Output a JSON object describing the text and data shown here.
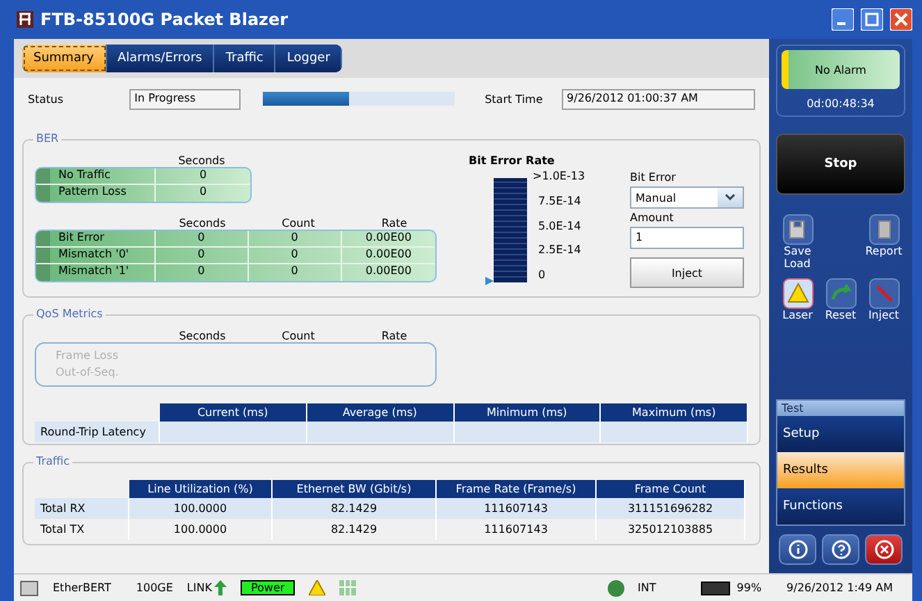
{
  "window": {
    "title": "FTB-85100G Packet Blazer"
  },
  "tabs": [
    {
      "label": "Summary",
      "selected": true
    },
    {
      "label": "Alarms/Errors",
      "selected": false
    },
    {
      "label": "Traffic",
      "selected": false
    },
    {
      "label": "Logger",
      "selected": false
    }
  ],
  "status": {
    "label": "Status",
    "value": "In Progress",
    "level": 0.45,
    "start_label": "Start Time",
    "start_value": "9/26/2012 01:00:37 AM"
  },
  "ber": {
    "title": "BER",
    "top_columns": [
      "Seconds"
    ],
    "top_rows": [
      {
        "name": "No Traffic",
        "cells": [
          "0"
        ]
      },
      {
        "name": "Pattern Loss",
        "cells": [
          "0"
        ]
      }
    ],
    "columns": [
      "Seconds",
      "Count",
      "Rate"
    ],
    "rows": [
      {
        "name": "Bit Error",
        "cells": [
          "0",
          "0",
          "0.00E00"
        ]
      },
      {
        "name": "Mismatch '0'",
        "cells": [
          "0",
          "0",
          "0.00E00"
        ]
      },
      {
        "name": "Mismatch '1'",
        "cells": [
          "0",
          "0",
          "0.00E00"
        ]
      }
    ],
    "meter": {
      "title": "Bit Error Rate",
      "level": 0,
      "ticks": [
        ">1.0E-13",
        "7.5E-14",
        "5.0E-14",
        "2.5E-14",
        "0"
      ]
    },
    "inject": {
      "type_label": "Bit Error",
      "type_value": "Manual",
      "amount_label": "Amount",
      "amount_value": "1",
      "button": "Inject"
    }
  },
  "qos": {
    "title": "QoS Metrics",
    "columns": [
      "Seconds",
      "Count",
      "Rate"
    ],
    "rows": [
      {
        "name": "Frame Loss",
        "disabled": true
      },
      {
        "name": "Out-of-Seq.",
        "disabled": true
      }
    ],
    "latency_columns": [
      "Current (ms)",
      "Average (ms)",
      "Minimum (ms)",
      "Maximum (ms)"
    ],
    "latency_row": "Round-Trip Latency"
  },
  "traffic": {
    "title": "Traffic",
    "columns": [
      "Line Utilization (%)",
      "Ethernet BW (Gbit/s)",
      "Frame Rate (Frame/s)",
      "Frame Count"
    ],
    "rows": [
      {
        "name": "Total RX",
        "cells": [
          "100.0000",
          "82.1429",
          "111607143",
          "311151696282"
        ]
      },
      {
        "name": "Total TX",
        "cells": [
          "100.0000",
          "82.1429",
          "111607143",
          "325012103885"
        ]
      }
    ]
  },
  "side": {
    "alarm": "No Alarm",
    "timer": "0d:00:48:34",
    "stop": "Stop",
    "tools": [
      {
        "kind": "save",
        "label": "Save\nLoad"
      },
      {
        "kind": "report",
        "label": "Report"
      },
      {
        "kind": "laser",
        "label": "Laser"
      },
      {
        "kind": "reset",
        "label": "Reset"
      },
      {
        "kind": "inject",
        "label": "Inject"
      }
    ],
    "menu_title": "Test",
    "menu": [
      {
        "label": "Setup",
        "selected": false
      },
      {
        "label": "Results",
        "selected": true
      },
      {
        "label": "Functions",
        "selected": false
      }
    ]
  },
  "status_bar": {
    "module": "EtherBERT",
    "rate": "100GE",
    "link": "LINK",
    "power": "Power",
    "clock": "INT",
    "battery": "99%",
    "datetime": "9/26/2012 1:49 AM"
  }
}
